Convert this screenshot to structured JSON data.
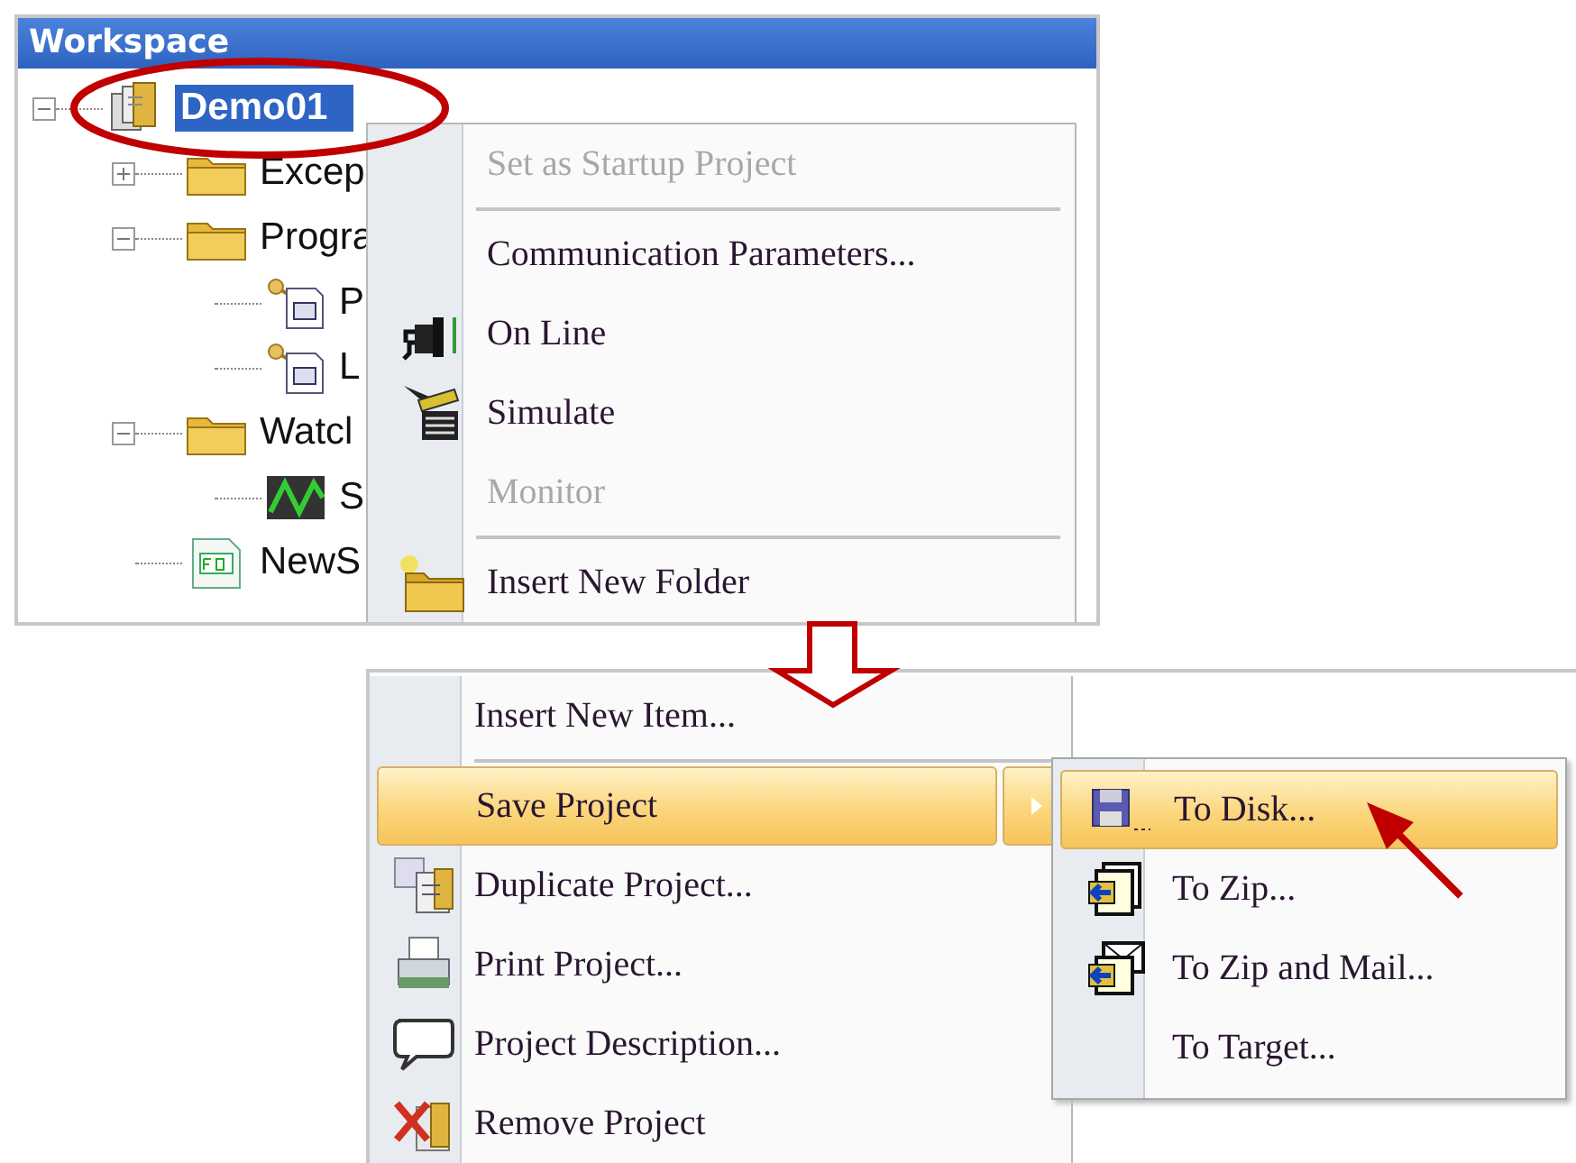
{
  "workspace": {
    "title": "Workspace",
    "tree": [
      {
        "label": "Demo01",
        "kind": "project",
        "selected": true,
        "expanded": true,
        "children": [
          {
            "label": "Excep",
            "kind": "folder",
            "selected": false,
            "expanded": false
          },
          {
            "label": "Progra",
            "kind": "folder",
            "selected": false,
            "expanded": true,
            "children": [
              {
                "label": "P",
                "kind": "program",
                "selected": false
              },
              {
                "label": "L",
                "kind": "program",
                "selected": false
              }
            ]
          },
          {
            "label": "Watcl",
            "kind": "folder",
            "selected": false,
            "expanded": true,
            "children": [
              {
                "label": "S",
                "kind": "chart",
                "selected": false
              }
            ]
          },
          {
            "label": "NewS",
            "kind": "block",
            "selected": false
          }
        ]
      }
    ]
  },
  "context_menu": {
    "items": [
      {
        "kind": "item",
        "label": "Set as Startup Project",
        "disabled": true
      },
      {
        "kind": "separator"
      },
      {
        "kind": "item",
        "label": "Communication Parameters...",
        "disabled": false
      },
      {
        "kind": "item",
        "label": "On Line",
        "disabled": false
      },
      {
        "kind": "item",
        "label": "Simulate",
        "disabled": false
      },
      {
        "kind": "item",
        "label": "Monitor",
        "disabled": true
      },
      {
        "kind": "separator"
      },
      {
        "kind": "item",
        "label": "Insert New Folder",
        "disabled": false
      }
    ]
  },
  "project_menu": {
    "items": [
      {
        "kind": "item",
        "label": "Insert New Item...",
        "selected": false,
        "submenu": false
      },
      {
        "kind": "separator"
      },
      {
        "kind": "item",
        "label": "Save Project",
        "selected": true,
        "submenu": true
      },
      {
        "kind": "item",
        "label": "Duplicate Project...",
        "selected": false,
        "submenu": false
      },
      {
        "kind": "item",
        "label": "Print Project...",
        "selected": false,
        "submenu": false
      },
      {
        "kind": "item",
        "label": "Project Description...",
        "selected": false,
        "submenu": false
      },
      {
        "kind": "item",
        "label": "Remove Project",
        "selected": false,
        "submenu": false
      }
    ]
  },
  "save_submenu": {
    "items": [
      {
        "label": "To Disk...",
        "selected": true
      },
      {
        "label": "To Zip...",
        "selected": false
      },
      {
        "label": "To Zip and Mail...",
        "selected": false
      },
      {
        "label": "To Target...",
        "selected": false
      }
    ]
  }
}
